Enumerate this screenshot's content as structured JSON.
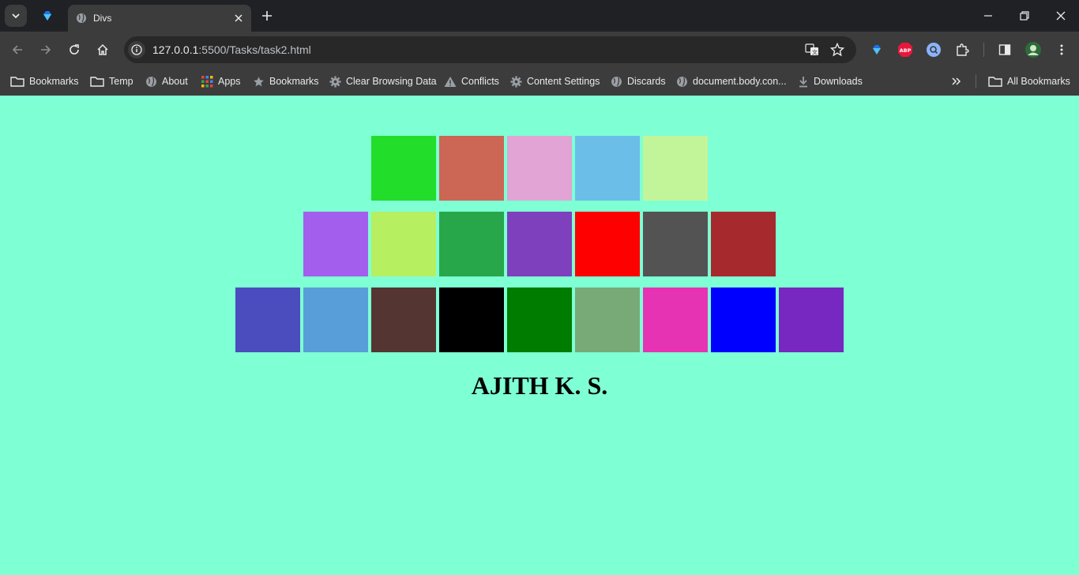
{
  "browser": {
    "tab_title": "Divs",
    "url_host": "127.0.0.1",
    "url_rest": ":5500/Tasks/task2.html"
  },
  "bookmarks": [
    {
      "label": "Bookmarks",
      "icon": "folder-icon"
    },
    {
      "label": "Temp",
      "icon": "folder-icon"
    },
    {
      "label": "About",
      "icon": "globe-icon"
    },
    {
      "label": "Apps",
      "icon": "apps-grid-icon"
    },
    {
      "label": "Bookmarks",
      "icon": "star-icon"
    },
    {
      "label": "Clear Browsing Data",
      "icon": "gear-icon"
    },
    {
      "label": "Conflicts",
      "icon": "warning-icon"
    },
    {
      "label": "Content Settings",
      "icon": "gear-icon"
    },
    {
      "label": "Discards",
      "icon": "globe-icon"
    },
    {
      "label": "document.body.con...",
      "icon": "globe-icon"
    },
    {
      "label": "Downloads",
      "icon": "download-icon"
    }
  ],
  "all_bookmarks_label": "All Bookmarks",
  "page": {
    "background": "#7fffd4",
    "heading": "AJITH K. S.",
    "rows": [
      [
        "#22dd2a",
        "#cc6655",
        "#e1a4d4",
        "#6bbee8",
        "#c2f59a"
      ],
      [
        "#a35eee",
        "#b6ef60",
        "#27a749",
        "#7e40bd",
        "#ff0000",
        "#535353",
        "#a62a2d"
      ],
      [
        "#4b4cbd",
        "#589ed8",
        "#543532",
        "#000000",
        "#007d00",
        "#78aa78",
        "#e633b4",
        "#0000ff",
        "#7628c0"
      ]
    ]
  }
}
